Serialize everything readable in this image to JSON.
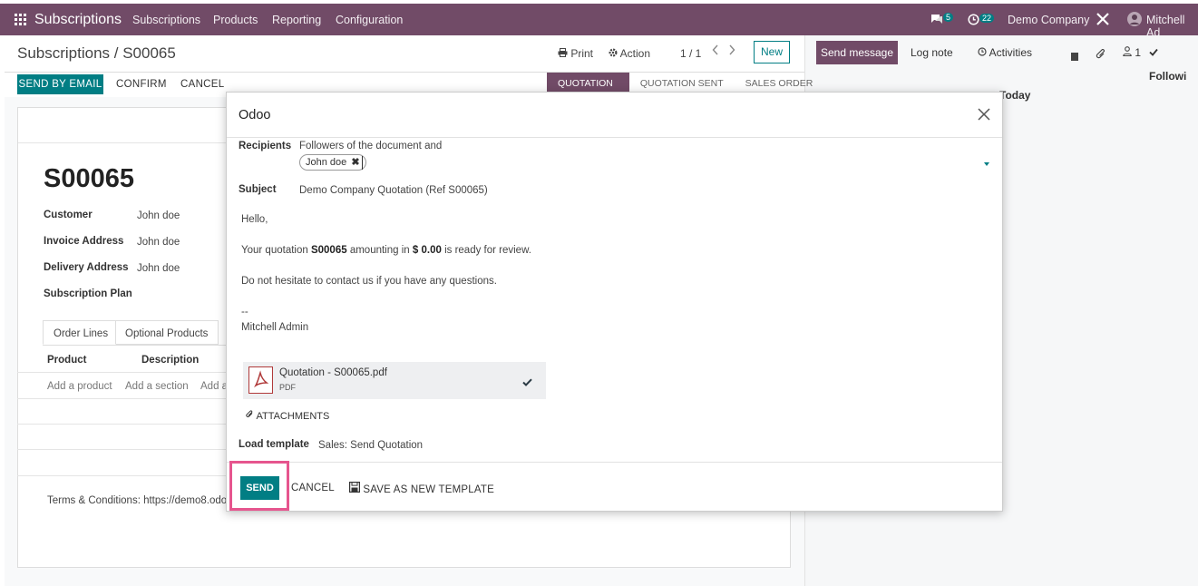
{
  "navbar": {
    "app_name": "Subscriptions",
    "menu": [
      "Subscriptions",
      "Products",
      "Reporting",
      "Configuration"
    ],
    "messages_count": "5",
    "activities_count": "22",
    "company": "Demo Company",
    "user": "Mitchell Ad"
  },
  "control_panel": {
    "breadcrumb": "Subscriptions / S00065",
    "print_label": "Print",
    "action_label": "Action",
    "pager": "1 / 1",
    "new_label": "New"
  },
  "action_bar": {
    "send_by_email": "SEND BY EMAIL",
    "confirm": "CONFIRM",
    "cancel": "CANCEL"
  },
  "statusbar": [
    "QUOTATION",
    "QUOTATION SENT",
    "SALES ORDER"
  ],
  "record": {
    "name": "S00065",
    "fields": [
      {
        "label": "Customer",
        "value": "John doe"
      },
      {
        "label": "Invoice Address",
        "value": "John doe"
      },
      {
        "label": "Delivery Address",
        "value": "John doe"
      },
      {
        "label": "Subscription Plan",
        "value": ""
      }
    ],
    "tabs": [
      "Order Lines",
      "Optional Products"
    ],
    "columns": [
      "Product",
      "Description"
    ],
    "row_actions": [
      "Add a product",
      "Add a section",
      "Add a"
    ],
    "terms": "Terms & Conditions: https://demo8.odo"
  },
  "chatter": {
    "send_message": "Send message",
    "log_note": "Log note",
    "activities": "Activities",
    "followers_count": "1",
    "following": "Followi",
    "today": "Today"
  },
  "dialog": {
    "title": "Odoo",
    "recipients_label": "Recipients",
    "recipients_text": "Followers of the document and",
    "recipient_tag": "John doe",
    "subject_label": "Subject",
    "subject": "Demo Company Quotation (Ref S00065)",
    "body_greeting": "Hello,",
    "body_line1_a": "Your quotation",
    "body_line1_b": "S00065",
    "body_line1_c": "amounting in",
    "body_line1_d": "$ 0.00",
    "body_line1_e": "is ready for review.",
    "body_line2": "Do not hesitate to contact us if you have any questions.",
    "signature_sep": "--",
    "signature_name": "Mitchell Admin",
    "attachment_name": "Quotation - S00065.pdf",
    "attachment_type": "PDF",
    "attachments_button": "ATTACHMENTS",
    "load_template_label": "Load template",
    "load_template_value": "Sales: Send Quotation",
    "send_button": "SEND",
    "cancel_button": "CANCEL",
    "save_template_button": "SAVE AS NEW TEMPLATE"
  },
  "colors": {
    "navbar": "#714b67",
    "primary": "#017e84",
    "highlight": "#e6558e"
  }
}
